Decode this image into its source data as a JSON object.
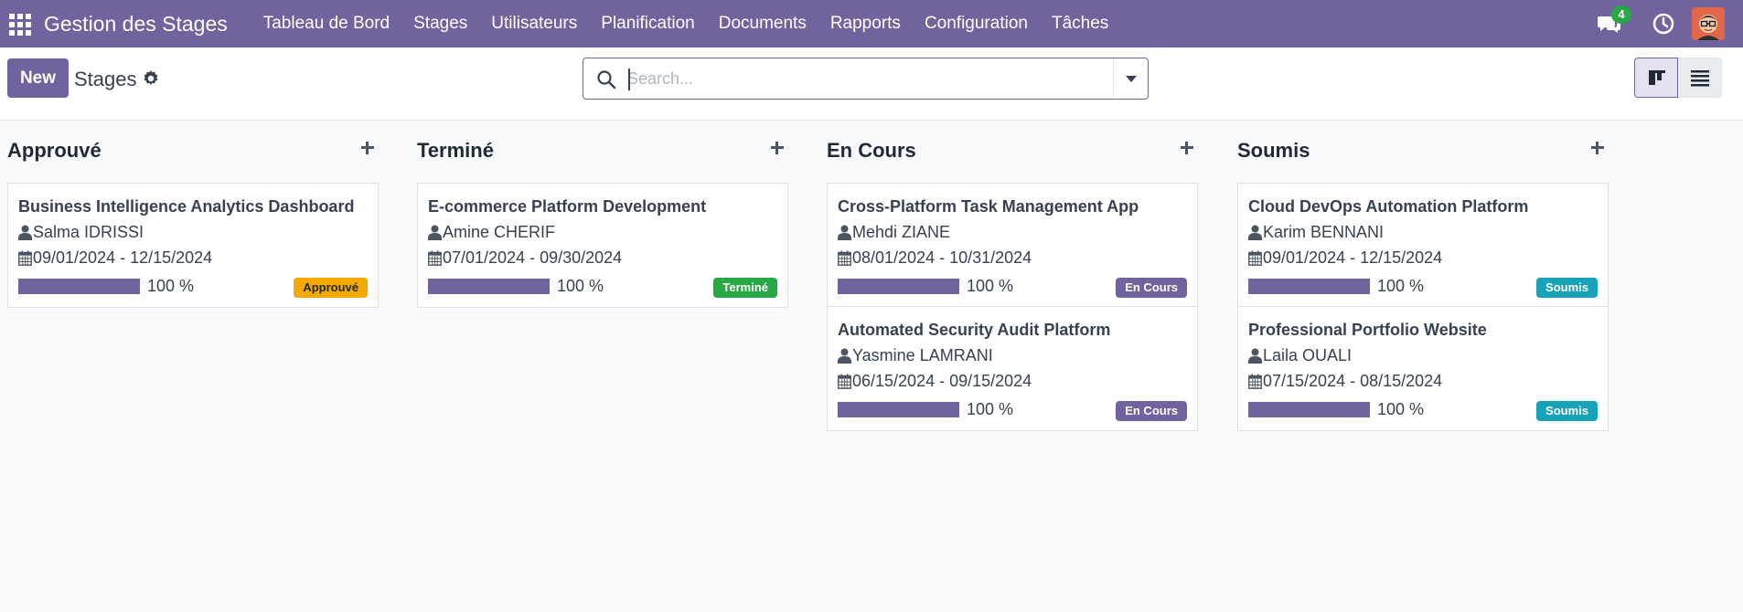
{
  "navbar": {
    "brand": "Gestion des Stages",
    "menu": [
      "Tableau de Bord",
      "Stages",
      "Utilisateurs",
      "Planification",
      "Documents",
      "Rapports",
      "Configuration",
      "Tâches"
    ],
    "chat_count": "4",
    "icons": [
      "apps-grid-icon",
      "chat-icon",
      "clock-icon",
      "user-avatar"
    ],
    "color": "#71639e"
  },
  "control": {
    "new_label": "New",
    "breadcrumb": "Stages",
    "search_placeholder": "Search...",
    "views": [
      "kanban-view",
      "list-view"
    ]
  },
  "columns": [
    {
      "title": "Approuvé",
      "cards": [
        {
          "title": "Business Intelligence Analytics Dashboard",
          "user": "Salma IDRISSI",
          "dates": "09/01/2024 - 12/15/2024",
          "progress": 100,
          "progress_label": "100 %",
          "badge": "Approuvé",
          "badge_color": "#f5a800",
          "badge_text_color": "#1f2937"
        }
      ]
    },
    {
      "title": "Terminé",
      "cards": [
        {
          "title": "E-commerce Platform Development",
          "user": "Amine CHERIF",
          "dates": "07/01/2024 - 09/30/2024",
          "progress": 100,
          "progress_label": "100 %",
          "badge": "Terminé",
          "badge_color": "#28a745",
          "badge_text_color": "#ffffff"
        }
      ]
    },
    {
      "title": "En Cours",
      "cards": [
        {
          "title": "Cross-Platform Task Management App",
          "user": "Mehdi ZIANE",
          "dates": "08/01/2024 - 10/31/2024",
          "progress": 100,
          "progress_label": "100 %",
          "badge": "En Cours",
          "badge_color": "#71639e",
          "badge_text_color": "#ffffff"
        },
        {
          "title": "Automated Security Audit Platform",
          "user": "Yasmine LAMRANI",
          "dates": "06/15/2024 - 09/15/2024",
          "progress": 100,
          "progress_label": "100 %",
          "badge": "En Cours",
          "badge_color": "#71639e",
          "badge_text_color": "#ffffff"
        }
      ]
    },
    {
      "title": "Soumis",
      "cards": [
        {
          "title": "Cloud DevOps Automation Platform",
          "user": "Karim BENNANI",
          "dates": "09/01/2024 - 12/15/2024",
          "progress": 100,
          "progress_label": "100 %",
          "badge": "Soumis",
          "badge_color": "#17a2b8",
          "badge_text_color": "#ffffff"
        },
        {
          "title": "Professional Portfolio Website",
          "user": "Laila OUALI",
          "dates": "07/15/2024 - 08/15/2024",
          "progress": 100,
          "progress_label": "100 %",
          "badge": "Soumis",
          "badge_color": "#17a2b8",
          "badge_text_color": "#ffffff"
        }
      ]
    }
  ]
}
